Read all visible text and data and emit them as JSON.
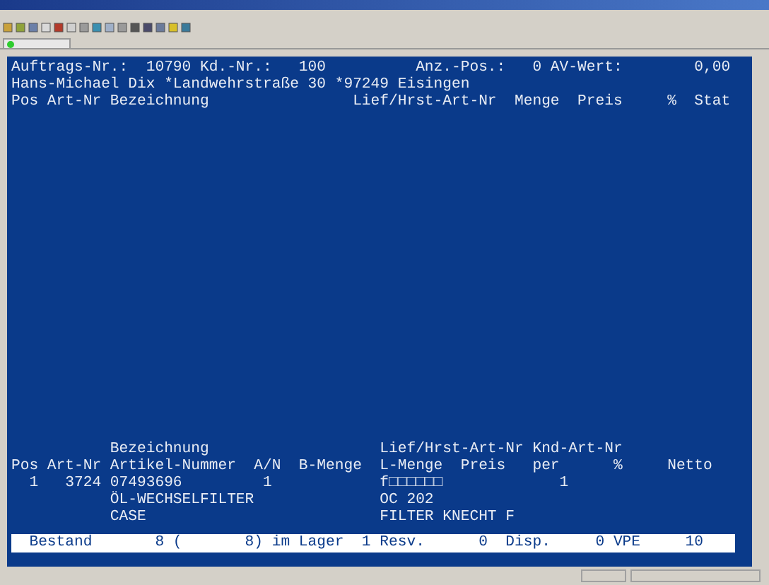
{
  "terminal": {
    "header_lines": [
      "Auftrags-Nr.:  10790 Kd.-Nr.:   100          Anz.-Pos.:   0 AV-Wert:        0,00",
      "Hans-Michael Dix *Landwehrstraße 30 *97249 Eisingen",
      "Pos Art-Nr Bezeichnung                Lief/Hrst-Art-Nr  Menge  Preis     %  Stat"
    ],
    "detail_lines": [
      "           Bezeichnung                   Lief/Hrst-Art-Nr Knd-Art-Nr",
      "Pos Art-Nr Artikel-Nummer  A/N  B-Menge  L-Menge  Preis   per      %     Netto",
      "  1   3724 07493696         1            f□□□□□□             1",
      "           ÖL-WECHSELFILTER              OC 202",
      "           CASE                          FILTER KNECHT F"
    ],
    "stock_bar": "  Bestand       8 (       8) im Lager  1 Resv.      0  Disp.     0 VPE     10"
  }
}
